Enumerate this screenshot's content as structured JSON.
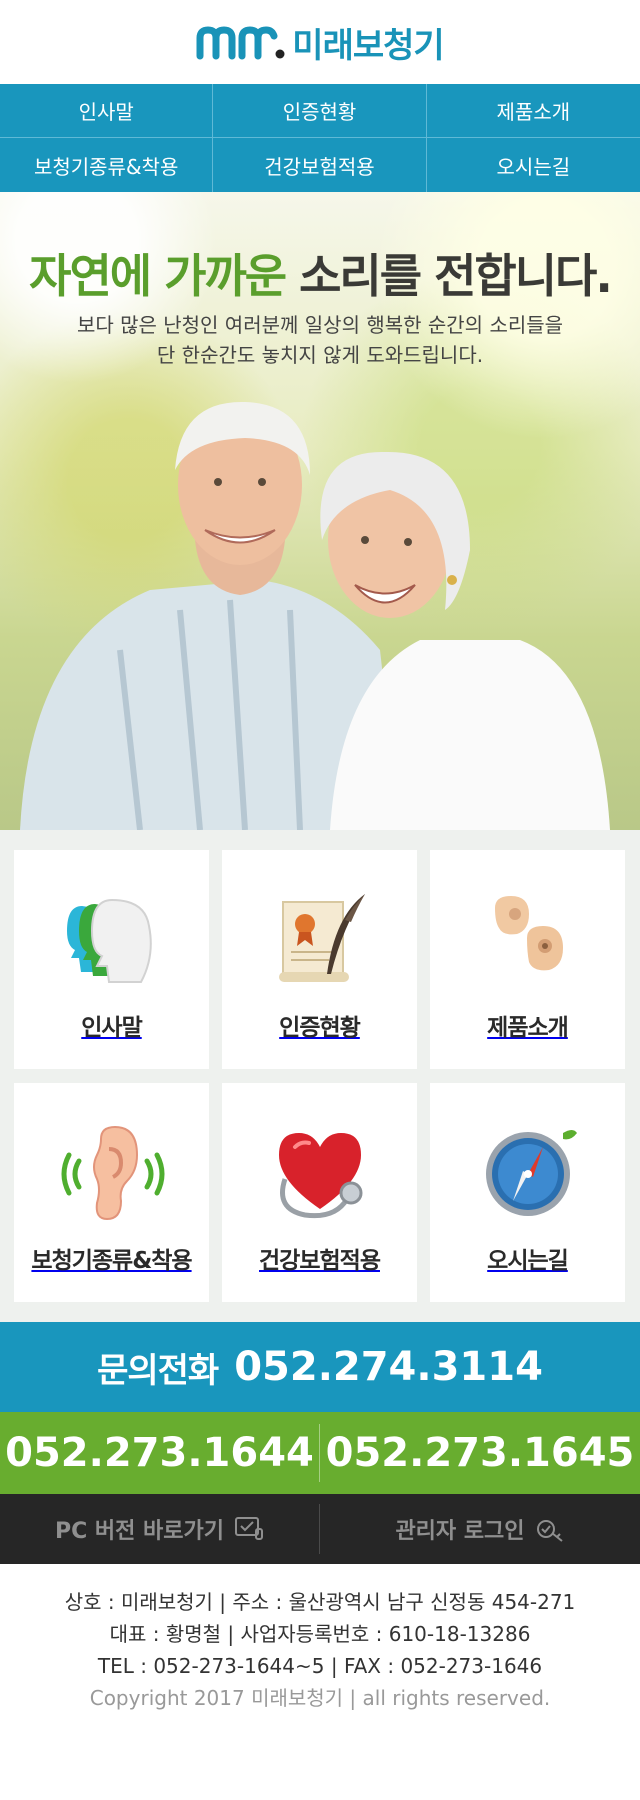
{
  "brand": {
    "name": "미래보청기",
    "mark_text": "mr"
  },
  "nav": [
    {
      "label": "인사말"
    },
    {
      "label": "인증현황"
    },
    {
      "label": "제품소개"
    },
    {
      "label": "보청기종류&착용"
    },
    {
      "label": "건강보험적용"
    },
    {
      "label": "오시는길"
    }
  ],
  "hero": {
    "title_green": "자연에 가까운",
    "title_dark": "소리를 전합니다.",
    "subtitle_line1": "보다 많은 난청인 여러분께 일상의 행복한 순간의 소리들을",
    "subtitle_line2": "단 한순간도 놓치지 않게 도와드립니다."
  },
  "menu": [
    {
      "label": "인사말",
      "icon": "heads-icon"
    },
    {
      "label": "인증현황",
      "icon": "certificate-icon"
    },
    {
      "label": "제품소개",
      "icon": "hearing-aid-icon"
    },
    {
      "label": "보청기종류&착용",
      "icon": "ear-icon"
    },
    {
      "label": "건강보험적용",
      "icon": "heart-stethoscope-icon"
    },
    {
      "label": "오시는길",
      "icon": "compass-icon"
    }
  ],
  "contact": {
    "main_label": "문의전화",
    "main_number": "052.274.3114",
    "number_left": "052.273.1644",
    "number_right": "052.273.1645"
  },
  "links": {
    "pc_version": "PC 버전 바로가기",
    "admin_login": "관리자 로그인"
  },
  "footer": {
    "line1": "상호 : 미래보청기 | 주소 : 울산광역시 남구 신정동 454-271",
    "line2": "대표 : 황명철  |  사업자등록번호 : 610-18-13286",
    "line3": "TEL : 052-273-1644~5  |  FAX : 052-273-1646",
    "copyright": "Copyright 2017 미래보청기 | all rights reserved."
  },
  "colors": {
    "primary": "#1996bd",
    "green": "#68ad2f",
    "title_green": "#5a9e2c",
    "dark_bar": "#262626"
  }
}
